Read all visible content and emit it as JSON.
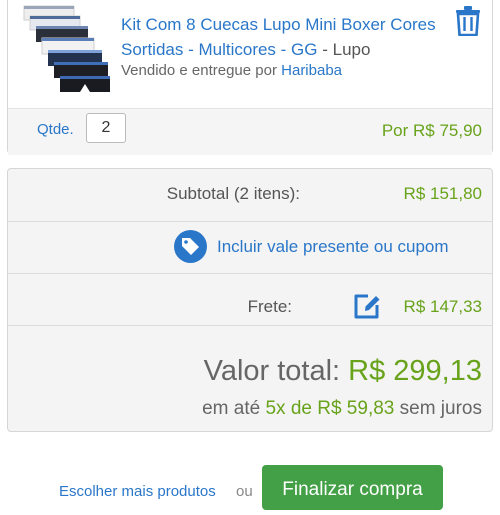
{
  "product": {
    "title": "Kit Com 8 Cuecas Lupo Mini Boxer Cores Sortidas - Multicores - GG",
    "brand_separator": " - ",
    "brand": "Lupo",
    "seller_prefix": "Vendido e entregue por ",
    "seller_name": "Haribaba",
    "qty_label": "Qtde.",
    "qty_value": "2",
    "unit_price": "Por R$ 75,90",
    "delete_icon": "trash-icon",
    "image_icon": "product-thumbnail"
  },
  "summary": {
    "subtotal_label": "Subtotal (2 itens):",
    "subtotal_value": "R$ 151,80",
    "coupon_label": "Incluir vale presente ou cupom",
    "coupon_icon": "tag-icon",
    "shipping_label": "Frete:",
    "shipping_value": "R$ 147,33",
    "shipping_edit_icon": "edit-icon",
    "total_label": "Valor total: ",
    "total_value": "R$ 299,13",
    "installments_prefix": "em até ",
    "installments_value": "5x de R$ 59,83",
    "installments_suffix": " sem juros"
  },
  "actions": {
    "more_products": "Escolher mais produtos",
    "or": "ou",
    "checkout": "Finalizar compra"
  },
  "colors": {
    "link_blue": "#2a77c9",
    "price_green": "#68a31b",
    "button_green": "#43a047",
    "panel_gray": "#f4f4f4"
  }
}
